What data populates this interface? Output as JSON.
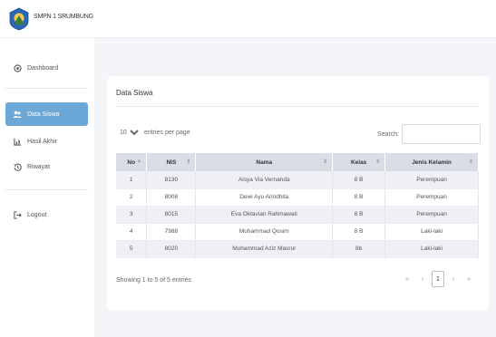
{
  "brand": {
    "name": "SMPN 1 SRUMBUNG"
  },
  "sidebar": {
    "items": [
      {
        "label": "Dashboard",
        "icon": "palette-icon"
      },
      {
        "label": "Data Siswa",
        "icon": "users-icon"
      },
      {
        "label": "Hasil Akhir",
        "icon": "chart-icon"
      },
      {
        "label": "Riwayat",
        "icon": "history-icon"
      },
      {
        "label": "Logout",
        "icon": "logout-icon"
      }
    ],
    "active_color": "#6ba7d7"
  },
  "card": {
    "title": "Data Siswa"
  },
  "controls": {
    "entries_value": "10",
    "entries_label": "entries per page",
    "search_label": "Search:",
    "search_value": ""
  },
  "table": {
    "headers": [
      "No",
      "NIS",
      "Nama",
      "Kelas",
      "Jenis Kelamin"
    ],
    "rows": [
      [
        "1",
        "8130",
        "Aisya Via Vernanda",
        "8 B",
        "Perempuan"
      ],
      [
        "2",
        "8008",
        "Dewi Ayu Arindhita",
        "8 B",
        "Perempuan"
      ],
      [
        "3",
        "8015",
        "Eva Oktavian Rahmawati",
        "8 B",
        "Perempuan"
      ],
      [
        "4",
        "7988",
        "Muhammad Qosim",
        "8 B",
        "Laki-laki"
      ],
      [
        "5",
        "8020",
        "Muhammad Aziz Masrur",
        "8b",
        "Laki-laki"
      ]
    ]
  },
  "footer": {
    "info": "Showing 1 to 5 of 5 entries",
    "pager": {
      "first": "«",
      "prev": "‹",
      "current": "1",
      "next": "›",
      "last": "»"
    }
  }
}
